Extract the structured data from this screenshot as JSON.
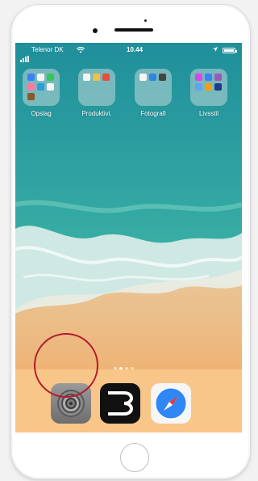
{
  "status_bar": {
    "carrier": "Telenor DK",
    "time": "10.44"
  },
  "folders": [
    {
      "label": "Opslag"
    },
    {
      "label": "Produktivi."
    },
    {
      "label": "Fotografi"
    },
    {
      "label": "Livsstil"
    }
  ],
  "dock": {
    "apps": [
      {
        "name": "settings-app-icon"
      },
      {
        "name": "b-app-icon"
      },
      {
        "name": "safari-app-icon"
      }
    ]
  },
  "colors": {
    "highlight": "#b3192a",
    "dock": "#fac88c",
    "sea": "#2c9da0"
  },
  "page_indicator": {
    "pages": 4,
    "active": 2
  }
}
